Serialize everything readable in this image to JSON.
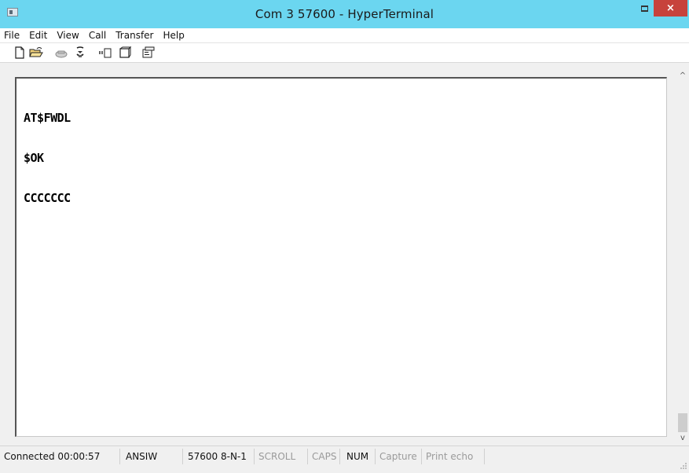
{
  "window": {
    "title": "Com 3 57600 - HyperTerminal",
    "close_glyph": "×",
    "colors": {
      "titlebar": "#6bd6f0",
      "close": "#c7423c"
    }
  },
  "menu": {
    "items": [
      "File",
      "Edit",
      "View",
      "Call",
      "Transfer",
      "Help"
    ]
  },
  "toolbar": {
    "icons": [
      "new-connection-icon",
      "open-folder-icon",
      "call-phone-icon",
      "hang-up-icon",
      "send-file-icon",
      "receive-file-icon",
      "properties-icon"
    ]
  },
  "terminal": {
    "lines": [
      "AT$FWDL",
      "$OK",
      "CCCCCCC"
    ]
  },
  "scrollbar": {
    "up_glyph": "^",
    "down_glyph": "v"
  },
  "status": {
    "connected": "Connected 00:00:57",
    "emulation": "ANSIW",
    "port_settings": "57600 8-N-1",
    "scroll": "SCROLL",
    "caps": "CAPS",
    "num": "NUM",
    "capture": "Capture",
    "print_echo": "Print echo"
  }
}
